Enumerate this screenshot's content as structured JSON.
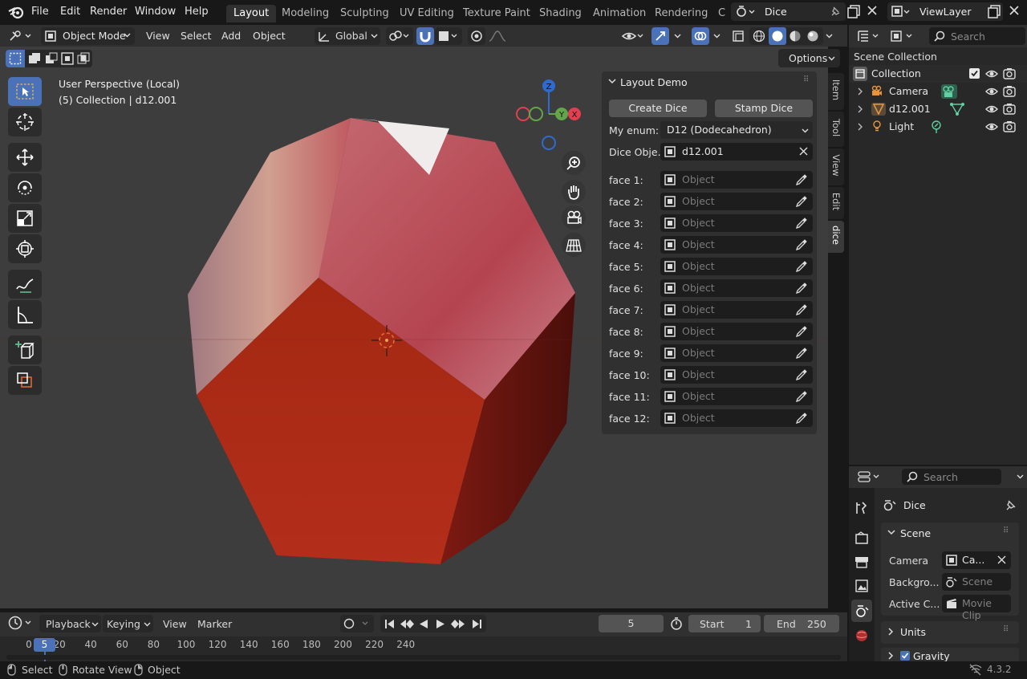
{
  "menu": {
    "file": "File",
    "edit": "Edit",
    "render": "Render",
    "window": "Window",
    "help": "Help"
  },
  "workspaces": [
    "Layout",
    "Modeling",
    "Sculpting",
    "UV Editing",
    "Texture Paint",
    "Shading",
    "Animation",
    "Rendering",
    "C"
  ],
  "scene_selector": {
    "value": "Dice"
  },
  "viewlayer_selector": {
    "value": "ViewLayer"
  },
  "viewport_header": {
    "mode": "Object Mode",
    "view": "View",
    "select": "Select",
    "add": "Add",
    "object": "Object",
    "transform_orientation": "Global",
    "options": "Options"
  },
  "viewport": {
    "perspective_label": "User Perspective (Local)",
    "collection_label": "(5) Collection | d12.001",
    "axis_x": "X",
    "axis_y": "Y",
    "axis_z": "Z"
  },
  "npanel": {
    "title": "Layout Demo",
    "create_button": "Create Dice",
    "stamp_button": "Stamp Dice",
    "enum_label": "My enum:",
    "enum_value": "D12 (Dodecahedron)",
    "dice_label": "Dice Obje...",
    "dice_value": "d12.001",
    "placeholder": "Object",
    "faces": [
      "face 1:",
      "face 2:",
      "face 3:",
      "face 4:",
      "face 5:",
      "face 6:",
      "face 7:",
      "face 8:",
      "face 9:",
      "face 10:",
      "face 11:",
      "face 12:"
    ]
  },
  "sidetabs": [
    "Item",
    "Tool",
    "View",
    "Edit",
    "dice"
  ],
  "outliner": {
    "search_placeholder": "Search",
    "scene_collection": "Scene Collection",
    "collection": "Collection",
    "items": [
      "Camera",
      "d12.001",
      "Light"
    ]
  },
  "properties": {
    "search_placeholder": "Search",
    "scene_name": "Dice",
    "scene_panel": "Scene",
    "camera_label": "Camera",
    "camera_value": "Ca...",
    "background_label": "Backgro...",
    "background_placeholder": "Scene",
    "active_clip_label": "Active C...",
    "active_clip_placeholder": "Movie Clip",
    "units_panel": "Units",
    "gravity_panel": "Gravity"
  },
  "timeline": {
    "playback": "Playback",
    "keying": "Keying",
    "view": "View",
    "marker": "Marker",
    "current_frame": "5",
    "start_label": "Start",
    "start_value": "1",
    "end_label": "End",
    "end_value": "250",
    "ruler": [
      "0",
      "20",
      "40",
      "60",
      "80",
      "100",
      "120",
      "140",
      "160",
      "180",
      "200",
      "220",
      "240"
    ],
    "playhead": "5"
  },
  "status": {
    "select": "Select",
    "rotate": "Rotate View",
    "object": "Object",
    "version": "4.3.2"
  }
}
